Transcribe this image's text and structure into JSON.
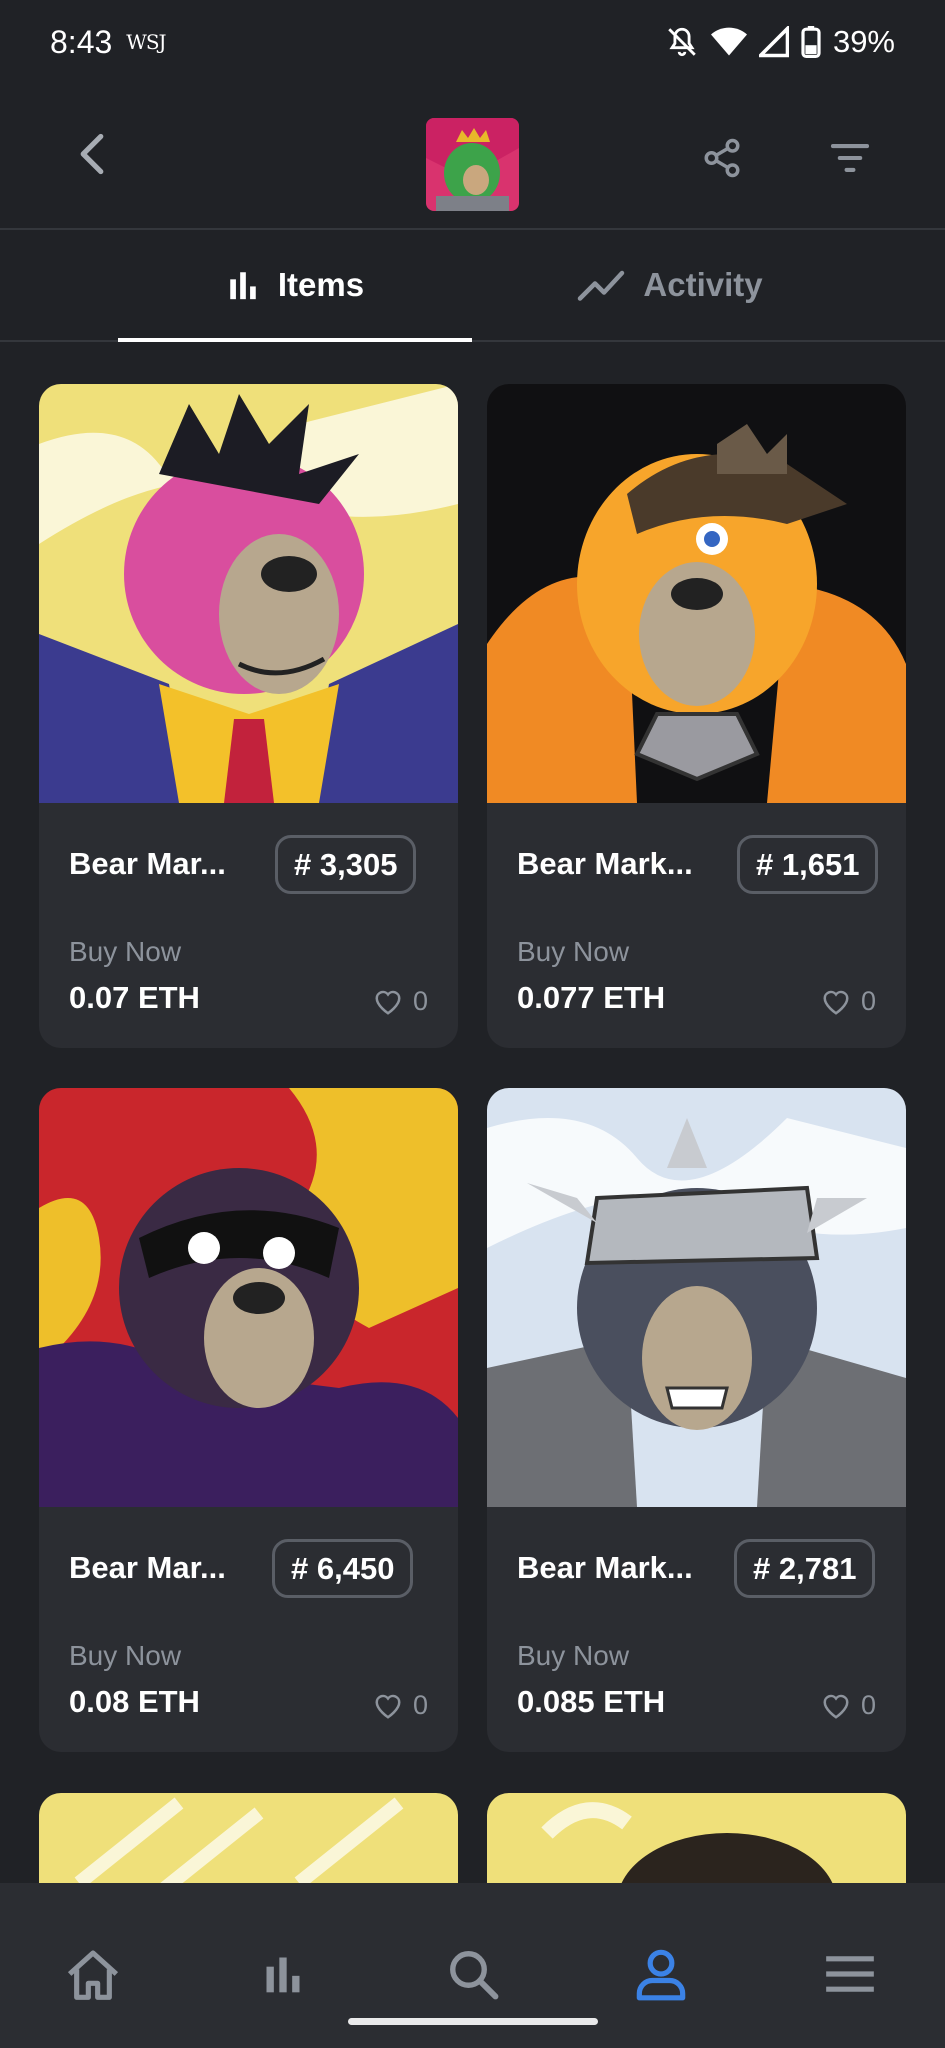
{
  "status_bar": {
    "time": "8:43",
    "app_badge": "WSJ",
    "battery": "39%"
  },
  "header": {
    "back_icon": "chevron-left-icon",
    "share_icon": "share-icon",
    "filter_icon": "filter-icon"
  },
  "tabs": [
    {
      "label": "Items",
      "icon": "bar-chart-icon",
      "active": true
    },
    {
      "label": "Activity",
      "icon": "trend-line-icon",
      "active": false
    }
  ],
  "items": [
    {
      "name": "Bear Mar...",
      "token": "# 3,305",
      "status": "Buy Now",
      "price": "0.07 ETH",
      "likes": "0"
    },
    {
      "name": "Bear Mark...",
      "token": "# 1,651",
      "status": "Buy Now",
      "price": "0.077 ETH",
      "likes": "0"
    },
    {
      "name": "Bear Mar...",
      "token": "# 6,450",
      "status": "Buy Now",
      "price": "0.08 ETH",
      "likes": "0"
    },
    {
      "name": "Bear Mark...",
      "token": "# 2,781",
      "status": "Buy Now",
      "price": "0.085 ETH",
      "likes": "0"
    }
  ],
  "bottom_nav": [
    {
      "name": "home",
      "icon": "home-icon",
      "active": false
    },
    {
      "name": "stats",
      "icon": "bar-chart-icon",
      "active": false
    },
    {
      "name": "search",
      "icon": "search-icon",
      "active": false
    },
    {
      "name": "profile",
      "icon": "person-icon",
      "active": true
    },
    {
      "name": "menu",
      "icon": "menu-icon",
      "active": false
    }
  ],
  "colors": {
    "background": "#202226",
    "card": "#2b2d32",
    "accent": "#3b82e6",
    "muted": "#8d939c"
  }
}
